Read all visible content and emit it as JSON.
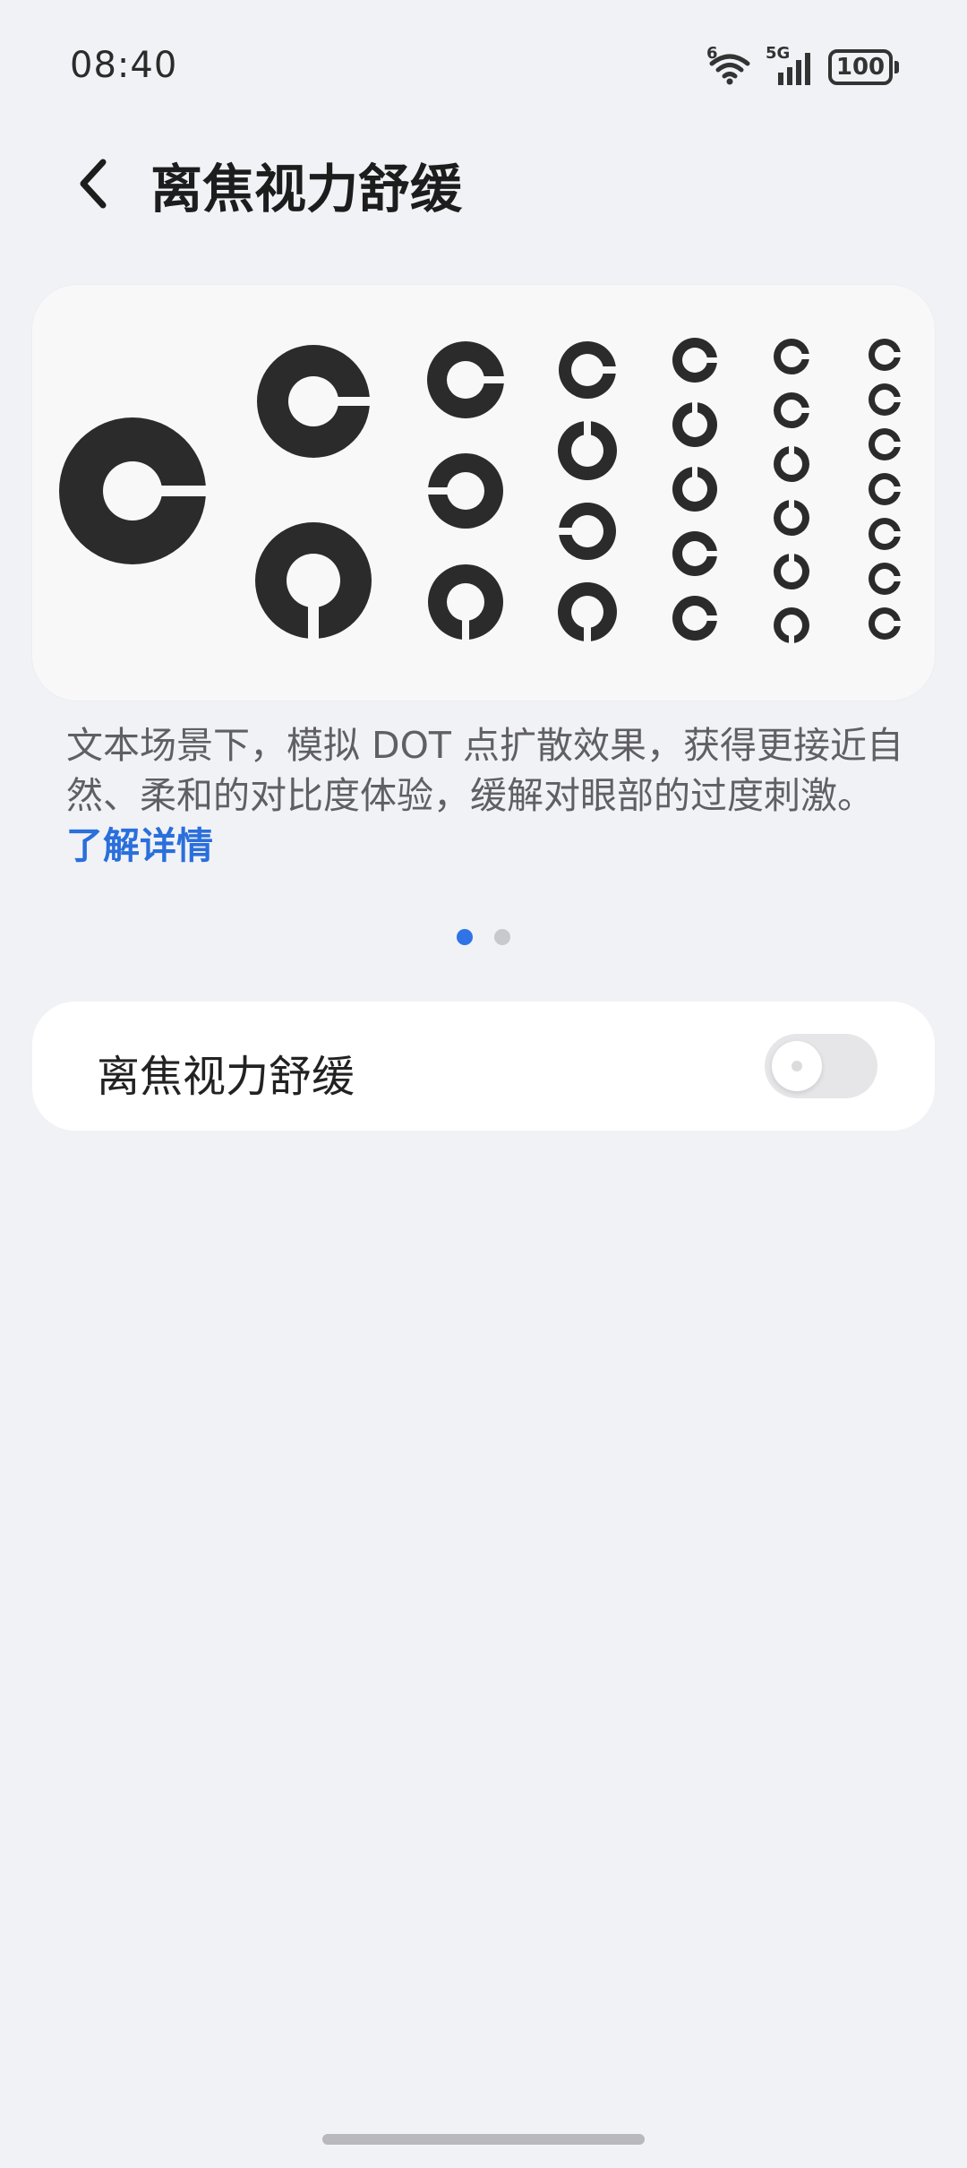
{
  "status_bar": {
    "time": "08:40",
    "wifi_label": "6",
    "network_label": "5G",
    "battery": "100",
    "icons": [
      "wifi-icon",
      "signal-icon",
      "battery-icon"
    ]
  },
  "header": {
    "title": "离焦视力舒缓",
    "back_icon": "chevron-left-icon"
  },
  "illustration": {
    "icon": "landolt-c-chart-icon"
  },
  "description": {
    "text": "文本场景下，模拟 DOT 点扩散效果，获得更接近自然、柔和的对比度体验，缓解对眼部的过度刺激。",
    "link": "了解详情"
  },
  "pager": {
    "total": 2,
    "active_index": 0
  },
  "setting": {
    "label": "离焦视力舒缓",
    "enabled": false
  },
  "colors": {
    "background": "#f1f2f6",
    "accent": "#2f73e6",
    "link": "#2a6fdb",
    "ring": "#2b2b2b"
  }
}
